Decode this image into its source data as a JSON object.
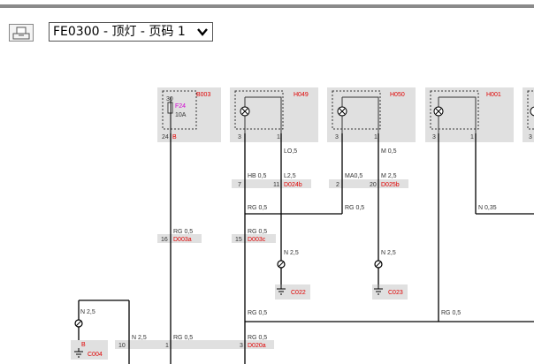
{
  "toolbar": {
    "print_icon": "printer-icon",
    "page_select_value": "FE0300 - 顶灯 - 页码 1",
    "page_select_icon": "chevron-down-icon"
  },
  "diagram": {
    "components": {
      "b003": {
        "id": "B003",
        "fuse": "F24",
        "amp": "10A",
        "pin_top": "30",
        "pin_a": "24",
        "pin_b": "B"
      },
      "h049": {
        "id": "H049",
        "pin_a": "3",
        "pin_b": "1"
      },
      "h050": {
        "id": "H050",
        "pin_a": "3",
        "pin_b": "1"
      },
      "h001": {
        "id": "H001",
        "pin_a": "3",
        "pin_b": "1"
      },
      "h_cut": {
        "pin_a": "3"
      }
    },
    "wires": {
      "lo05": "LO,5",
      "hb05": "HB 0,5",
      "l25": "L2,5",
      "m05": "M 0,5",
      "ma05": "MA0,5",
      "m25": "M 2,5",
      "rg05_a": "RG 0,5",
      "rg05_b": "RG 0,5",
      "rg05_c": "RG 0,5",
      "rg05_d": "RG 0,5",
      "rg05_e": "RG 0,5",
      "rg05_f": "RG 0,5",
      "rg05_g": "RG 0,5",
      "n035": "N 0,35",
      "n25_a": "N 2,5",
      "n25_b": "N 2,5",
      "n25_c": "N 2,5",
      "n25_d": "N 2,5"
    },
    "connectors": {
      "d024b": {
        "label": "D024b",
        "pin_a": "7",
        "pin_b": "11"
      },
      "d025b": {
        "label": "D025b",
        "pin_a": "2",
        "pin_b": "20"
      },
      "d003a": {
        "label": "D003a",
        "pin": "16"
      },
      "d003c": {
        "label": "D003c",
        "pin": "15"
      },
      "d020a": {
        "label": "D020a",
        "pin_a": "10",
        "pin_b": "1",
        "pin_c": "3"
      }
    },
    "grounds": {
      "c022": "C022",
      "c023": "C023",
      "c004": {
        "label": "C004",
        "pin": "B"
      }
    }
  },
  "colors": {
    "accent_red": "#e00000",
    "fuse_magenta": "#d000d0",
    "box_gray": "#e0e0e0"
  }
}
